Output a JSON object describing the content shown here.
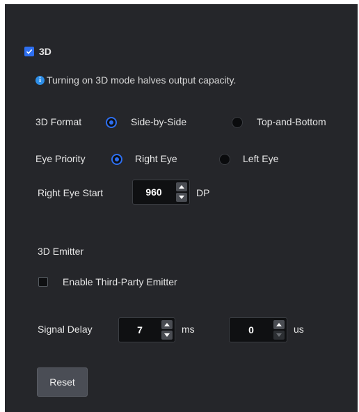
{
  "mode3d": {
    "label": "3D",
    "checked": true
  },
  "info": {
    "text": "Turning on 3D mode halves output capacity."
  },
  "format": {
    "label": "3D Format",
    "options": [
      "Side-by-Side",
      "Top-and-Bottom"
    ],
    "selected": "Side-by-Side"
  },
  "eye_priority": {
    "label": "Eye Priority",
    "options": [
      "Right Eye",
      "Left Eye"
    ],
    "selected": "Right Eye"
  },
  "right_eye_start": {
    "label": "Right Eye Start",
    "value": "960",
    "unit": "DP"
  },
  "emitter": {
    "section_label": "3D Emitter",
    "enable_label": "Enable Third-Party Emitter",
    "enabled": false
  },
  "signal_delay": {
    "label": "Signal Delay",
    "ms_value": "7",
    "ms_unit": "ms",
    "us_value": "0",
    "us_unit": "us"
  },
  "reset_button": {
    "label": "Reset"
  },
  "colors": {
    "background": "#25262a",
    "accent": "#2e6ff0",
    "info": "#2e8fe8",
    "text": "#e6e6e6"
  }
}
